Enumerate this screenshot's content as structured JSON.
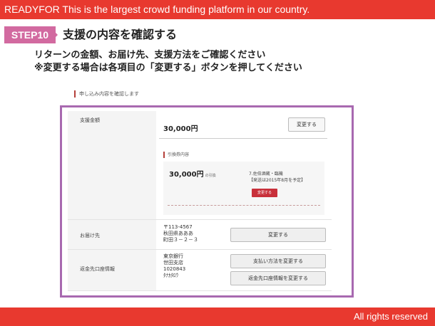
{
  "header": {
    "text": "READYFOR This is the largest crowd funding platform in our country."
  },
  "footer": {
    "text": "All rights reserved"
  },
  "step": {
    "badge": "STEP10",
    "title": "支援の内容を確認する"
  },
  "instructions": {
    "line1": "リターンの金額、お届け先、支援方法をご確認ください",
    "line2": "※変更する場合は各項目の「変更する」ボタンを押してください"
  },
  "screen": {
    "section_label": "申し込み内容を確認します",
    "support": {
      "label": "支援金額",
      "amount": "30,000円",
      "change_label": "変更する"
    },
    "reward": {
      "label": "引換券内容",
      "amount": "30,000円",
      "amount_suffix": "の引換",
      "name": "7.佐伯酒蔵・臨機",
      "date": "【発送は2015年8月を予定】",
      "change_label": "変更する"
    },
    "delivery": {
      "label": "お届け先",
      "address": [
        "〒113-4567",
        "秋田県あああ",
        "町田３－２－３"
      ],
      "change_label": "変更する"
    },
    "bank": {
      "label": "返金先口座情報",
      "details": [
        "東京銀行",
        "世田支店",
        "1020843",
        "ﾀﾅｶﾀﾛｳ"
      ],
      "payment_change_label": "支払い方法を変更する",
      "bank_change_label": "返金先口座情報を変更する"
    }
  },
  "colors": {
    "brand_red": "#e8392f",
    "step_pink": "#d26aa0",
    "frame_purple": "#a869b0"
  }
}
